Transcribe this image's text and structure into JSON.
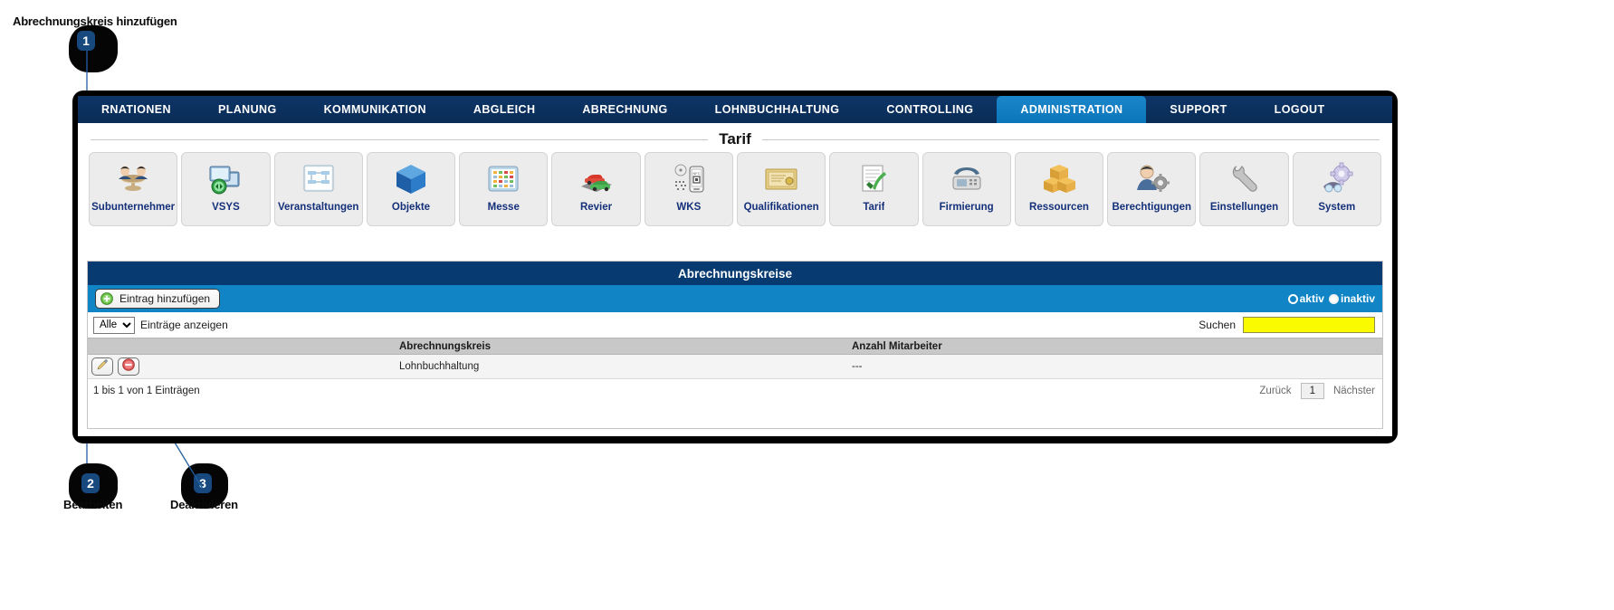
{
  "annotations": [
    {
      "number": "1",
      "label": "Abrechnungskreis hinzufügen"
    },
    {
      "number": "2",
      "label": "Bearbeiten"
    },
    {
      "number": "3",
      "label": "Deaktivieren"
    }
  ],
  "topnav": {
    "items": [
      {
        "label": "RNATIONEN",
        "active": false
      },
      {
        "label": "PLANUNG",
        "active": false
      },
      {
        "label": "KOMMUNIKATION",
        "active": false
      },
      {
        "label": "ABGLEICH",
        "active": false
      },
      {
        "label": "ABRECHNUNG",
        "active": false
      },
      {
        "label": "LOHNBUCHHALTUNG",
        "active": false
      },
      {
        "label": "CONTROLLING",
        "active": false
      },
      {
        "label": "ADMINISTRATION",
        "active": true
      },
      {
        "label": "SUPPORT",
        "active": false
      },
      {
        "label": "LOGOUT",
        "active": false
      }
    ]
  },
  "module": {
    "heading": "Tarif",
    "icons": [
      {
        "label": "Subunternehmer",
        "icon": "people-table-icon"
      },
      {
        "label": "VSYS",
        "icon": "monitors-sync-icon"
      },
      {
        "label": "Veranstaltungen",
        "icon": "flowchart-board-icon"
      },
      {
        "label": "Objekte",
        "icon": "blue-cube-icon"
      },
      {
        "label": "Messe",
        "icon": "calendar-icon"
      },
      {
        "label": "Revier",
        "icon": "cars-icon"
      },
      {
        "label": "WKS",
        "icon": "nfc-phone-icon"
      },
      {
        "label": "Qualifikationen",
        "icon": "certificate-icon"
      },
      {
        "label": "Tarif",
        "icon": "document-check-icon"
      },
      {
        "label": "Firmierung",
        "icon": "telephone-icon"
      },
      {
        "label": "Ressourcen",
        "icon": "boxes-icon"
      },
      {
        "label": "Berechtigungen",
        "icon": "user-gear-icon"
      },
      {
        "label": "Einstellungen",
        "icon": "wrench-icon"
      },
      {
        "label": "System",
        "icon": "gears-icon"
      }
    ]
  },
  "panel": {
    "title": "Abrechnungskreise",
    "add_button": "Eintrag hinzufügen",
    "add_button_icon": "plus-circle-icon",
    "status_filter": {
      "options": [
        {
          "label": "aktiv",
          "selected": false
        },
        {
          "label": "inaktiv",
          "selected": true
        }
      ]
    },
    "entries_select": {
      "value": "Alle",
      "options": [
        "Alle"
      ]
    },
    "entries_label": "Einträge anzeigen",
    "search_label": "Suchen",
    "search_value": "",
    "search_placeholder": "",
    "table": {
      "columns": [
        "",
        "Abrechnungskreis",
        "Anzahl Mitarbeiter"
      ],
      "rows": [
        {
          "actions": [
            {
              "name": "edit-row-button",
              "icon": "pencil-icon"
            },
            {
              "name": "deactivate-row-button",
              "icon": "minus-circle-icon"
            }
          ],
          "abrechnungskreis": "Lohnbuchhaltung",
          "anzahl_mitarbeiter": "---"
        }
      ]
    },
    "footer": {
      "info": "1 bis 1 von 1 Einträgen",
      "prev": "Zurück",
      "page": "1",
      "next": "Nächster"
    }
  },
  "colors": {
    "nav_dark": "#0d3567",
    "nav_active": "#1084c4",
    "panel_header": "#063a70",
    "toolbar": "#1084c4",
    "search_yellow": "#fbfb00",
    "label_blue": "#14307a",
    "badge_blue": "#17487e"
  }
}
